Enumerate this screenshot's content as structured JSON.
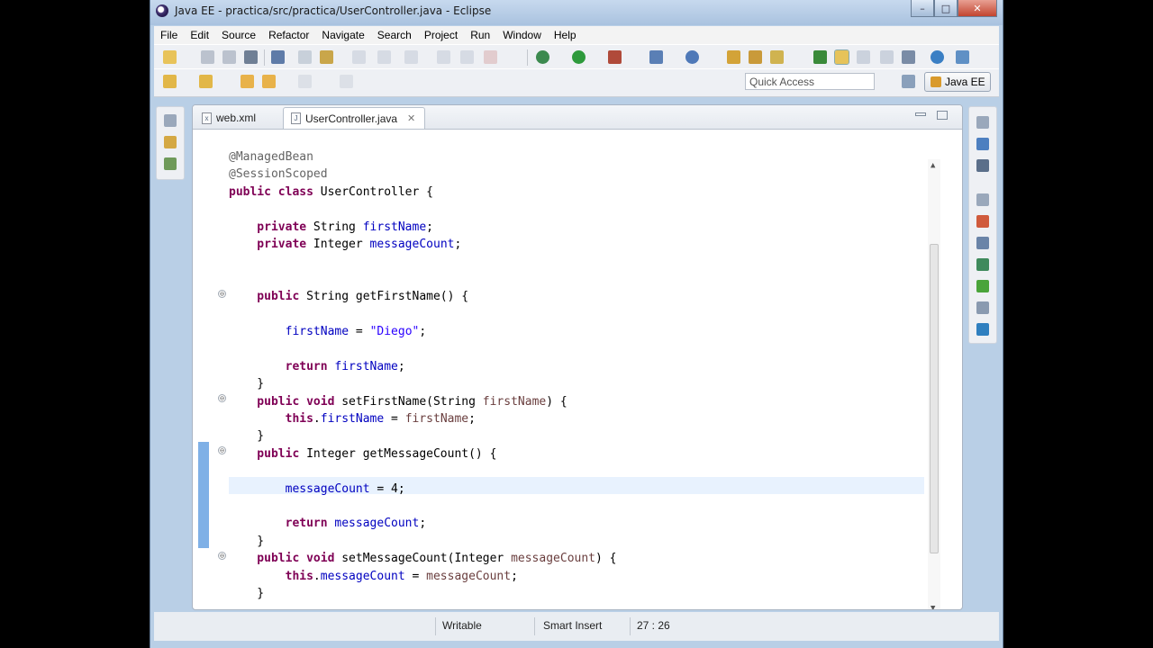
{
  "window": {
    "title": "Java EE - practica/src/practica/UserController.java - Eclipse",
    "controls": {
      "minimize": "–",
      "maximize": "□",
      "close": "✕"
    }
  },
  "menu": [
    "File",
    "Edit",
    "Source",
    "Refactor",
    "Navigate",
    "Search",
    "Project",
    "Run",
    "Window",
    "Help"
  ],
  "toolbar": {
    "quick_access_placeholder": "Quick Access",
    "perspective": "Java EE"
  },
  "editor": {
    "tabs": [
      {
        "label": "web.xml",
        "icon": "xml-file-icon",
        "active": false
      },
      {
        "label": "UserController.java",
        "icon": "java-file-icon",
        "active": true,
        "close": "✕"
      }
    ]
  },
  "code": {
    "lines": [
      [
        {
          "t": "@ManagedBean",
          "c": "ann"
        }
      ],
      [
        {
          "t": "@SessionScoped",
          "c": "ann"
        }
      ],
      [
        {
          "t": "public class ",
          "c": "kw"
        },
        {
          "t": "UserController {",
          "c": ""
        }
      ],
      [],
      [
        {
          "t": "    private ",
          "c": "kw"
        },
        {
          "t": "String ",
          "c": ""
        },
        {
          "t": "firstName",
          "c": "fld"
        },
        {
          "t": ";",
          "c": ""
        }
      ],
      [
        {
          "t": "    private ",
          "c": "kw"
        },
        {
          "t": "Integer ",
          "c": ""
        },
        {
          "t": "messageCount",
          "c": "fld"
        },
        {
          "t": ";",
          "c": ""
        }
      ],
      [],
      [],
      [
        {
          "t": "    public ",
          "c": "kw"
        },
        {
          "t": "String getFirstName() {",
          "c": ""
        }
      ],
      [],
      [
        {
          "t": "        ",
          "c": ""
        },
        {
          "t": "firstName",
          "c": "fld"
        },
        {
          "t": " = ",
          "c": ""
        },
        {
          "t": "\"Diego\"",
          "c": "str"
        },
        {
          "t": ";",
          "c": ""
        }
      ],
      [],
      [
        {
          "t": "        return ",
          "c": "kw"
        },
        {
          "t": "firstName",
          "c": "fld"
        },
        {
          "t": ";",
          "c": ""
        }
      ],
      [
        {
          "t": "    }",
          "c": ""
        }
      ],
      [
        {
          "t": "    public void ",
          "c": "kw"
        },
        {
          "t": "setFirstName(String ",
          "c": ""
        },
        {
          "t": "firstName",
          "c": "prm"
        },
        {
          "t": ") {",
          "c": ""
        }
      ],
      [
        {
          "t": "        this",
          "c": "kw"
        },
        {
          "t": ".",
          "c": ""
        },
        {
          "t": "firstName",
          "c": "fld"
        },
        {
          "t": " = ",
          "c": ""
        },
        {
          "t": "firstName",
          "c": "prm"
        },
        {
          "t": ";",
          "c": ""
        }
      ],
      [
        {
          "t": "    }",
          "c": ""
        }
      ],
      [
        {
          "t": "    public ",
          "c": "kw"
        },
        {
          "t": "Integer getMessageCount() {",
          "c": ""
        }
      ],
      [],
      [
        {
          "t": "        ",
          "c": ""
        },
        {
          "t": "messageCount",
          "c": "fld"
        },
        {
          "t": " = 4;",
          "c": ""
        }
      ],
      [],
      [
        {
          "t": "        return ",
          "c": "kw"
        },
        {
          "t": "messageCount",
          "c": "fld"
        },
        {
          "t": ";",
          "c": ""
        }
      ],
      [
        {
          "t": "    }",
          "c": ""
        }
      ],
      [
        {
          "t": "    public void ",
          "c": "kw"
        },
        {
          "t": "setMessageCount(Integer ",
          "c": ""
        },
        {
          "t": "messageCount",
          "c": "prm"
        },
        {
          "t": ") {",
          "c": ""
        }
      ],
      [
        {
          "t": "        this",
          "c": "kw"
        },
        {
          "t": ".",
          "c": ""
        },
        {
          "t": "messageCount",
          "c": "fld"
        },
        {
          "t": " = ",
          "c": ""
        },
        {
          "t": "messageCount",
          "c": "prm"
        },
        {
          "t": ";",
          "c": ""
        }
      ],
      [
        {
          "t": "    }",
          "c": ""
        }
      ]
    ],
    "highlighted_line": 20,
    "fold_markers": [
      "⊖",
      "⊖",
      "⊖",
      "⊖",
      "⊖"
    ]
  },
  "status": {
    "writable": "Writable",
    "insert_mode": "Smart Insert",
    "cursor": "27 : 26"
  },
  "colors": {
    "keyword": "#7f0055",
    "field": "#0000c0",
    "string": "#2a00ff",
    "annotation": "#646464",
    "parameter": "#6a3e3e",
    "current_line": "#e8f2fe",
    "change_bar": "#7fb0e6"
  }
}
